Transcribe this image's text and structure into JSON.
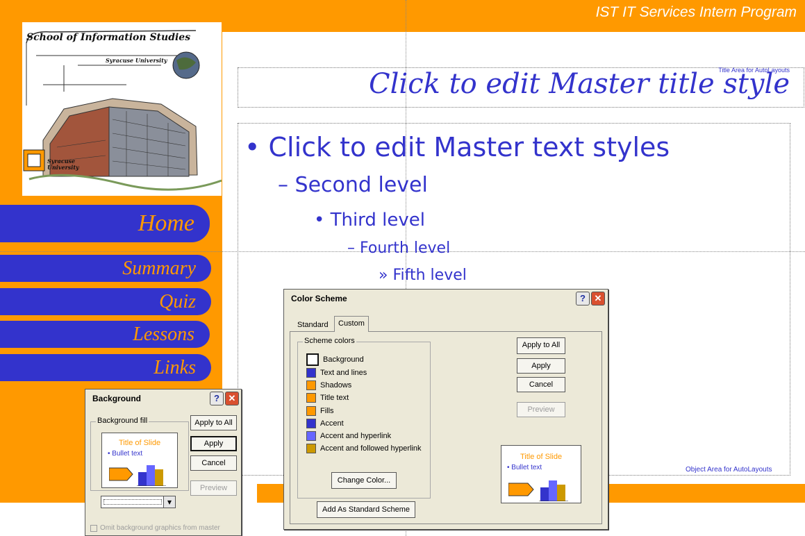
{
  "header": {
    "program_title": "IST IT Services Intern Program"
  },
  "logo": {
    "school": "School of Information Studies",
    "university": "Syracuse University",
    "seal_text": "Syracuse University"
  },
  "nav": [
    {
      "label": "Home"
    },
    {
      "label": "Summary"
    },
    {
      "label": "Quiz"
    },
    {
      "label": "Lessons"
    },
    {
      "label": "Links"
    }
  ],
  "master": {
    "title": "Click to edit Master title style",
    "title_area_label": "Title Area for AutoLayouts",
    "levels": [
      "• Click to edit Master text styles",
      "– Second level",
      "• Third level",
      "– Fourth level",
      "» Fifth level"
    ],
    "object_area_label": "Object Area for AutoLayouts"
  },
  "color_scheme_dialog": {
    "title": "Color Scheme",
    "tabs": [
      {
        "label": "Standard"
      },
      {
        "label": "Custom"
      }
    ],
    "group_label": "Scheme colors",
    "items": [
      {
        "label": "Background",
        "color": "#ffffff"
      },
      {
        "label": "Text and lines",
        "color": "#3333cc"
      },
      {
        "label": "Shadows",
        "color": "#ff9900"
      },
      {
        "label": "Title text",
        "color": "#ff9900"
      },
      {
        "label": "Fills",
        "color": "#ff9900"
      },
      {
        "label": "Accent",
        "color": "#3333cc"
      },
      {
        "label": "Accent and hyperlink",
        "color": "#6666ff"
      },
      {
        "label": "Accent and followed hyperlink",
        "color": "#cc9900"
      }
    ],
    "buttons": {
      "apply_all": "Apply to All",
      "apply": "Apply",
      "cancel": "Cancel",
      "preview": "Preview",
      "change_color": "Change Color...",
      "add_standard": "Add As Standard Scheme"
    },
    "preview": {
      "title": "Title of Slide",
      "bullet": "•  Bullet text"
    },
    "help_symbol": "?",
    "close_symbol": "✕"
  },
  "background_dialog": {
    "title": "Background",
    "group_label": "Background fill",
    "preview": {
      "title": "Title of Slide",
      "bullet": "•  Bullet text"
    },
    "buttons": {
      "apply_all": "Apply to All",
      "apply": "Apply",
      "cancel": "Cancel",
      "preview": "Preview"
    },
    "omit_label": "Omit background graphics from master",
    "dropdown_arrow": "▾",
    "help_symbol": "?",
    "close_symbol": "✕"
  },
  "colors": {
    "orange": "#ff9900",
    "blue": "#3333cc",
    "dialog_bg": "#ece9d8"
  }
}
